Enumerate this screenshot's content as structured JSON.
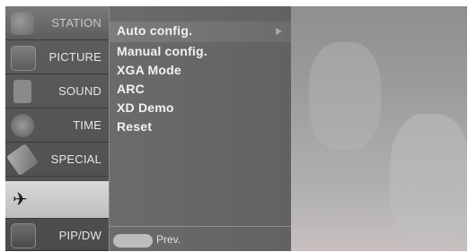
{
  "sidebar": {
    "items": [
      {
        "label": "STATION",
        "icon": "station-icon"
      },
      {
        "label": "PICTURE",
        "icon": "picture-icon"
      },
      {
        "label": "SOUND",
        "icon": "sound-icon"
      },
      {
        "label": "TIME",
        "icon": "time-icon"
      },
      {
        "label": "SPECIAL",
        "icon": "special-icon"
      },
      {
        "label": "",
        "icon": "screen-icon"
      },
      {
        "label": "PIP/DW",
        "icon": "pip-icon"
      }
    ]
  },
  "menu": {
    "items": [
      "Auto config.",
      "Manual config.",
      "XGA Mode",
      "ARC",
      "XD Demo",
      "Reset"
    ],
    "prev_label": "Prev."
  }
}
